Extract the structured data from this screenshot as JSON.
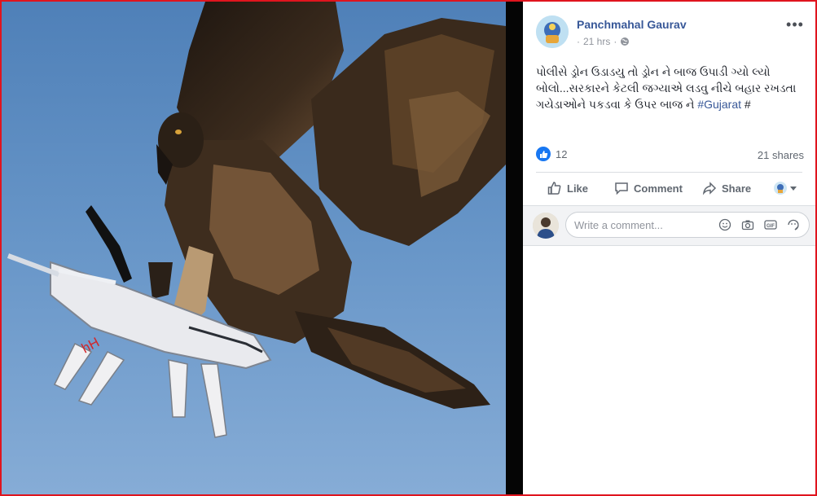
{
  "post": {
    "author": "Panchmahal Gaurav",
    "time": "21 hrs",
    "text_main": "પોલીસે ડ્રોન ઉડાડયુ તો ડ્રોન ને બાજ ઉપાડી ગ્યો લ્યો બોલો...સરકારને કેટલી જગ્યાએ લડવુ નીચે બહાર રખડતા ગયેડાઓને પકડવા કે ઉપર બાજ ને ",
    "hashtag": "#Gujarat",
    "trailing": " #",
    "photo_watermark": "hH"
  },
  "stats": {
    "reaction_count": "12",
    "shares": "21 shares"
  },
  "actions": {
    "like": "Like",
    "comment": "Comment",
    "share": "Share"
  },
  "comment": {
    "placeholder": "Write a comment..."
  },
  "icons": {
    "more": "more-options-icon",
    "globe": "globe-icon",
    "like": "thumbs-up-icon",
    "comment": "speech-bubble-icon",
    "share": "share-arrow-icon",
    "caret": "caret-down-icon",
    "emoji": "emoji-icon",
    "camera": "camera-icon",
    "gif": "gif-icon",
    "sticker": "sticker-icon"
  },
  "colors": {
    "link": "#385898",
    "accent": "#1877f2",
    "sky": "#5d8fc2",
    "border": "#e0141e"
  }
}
